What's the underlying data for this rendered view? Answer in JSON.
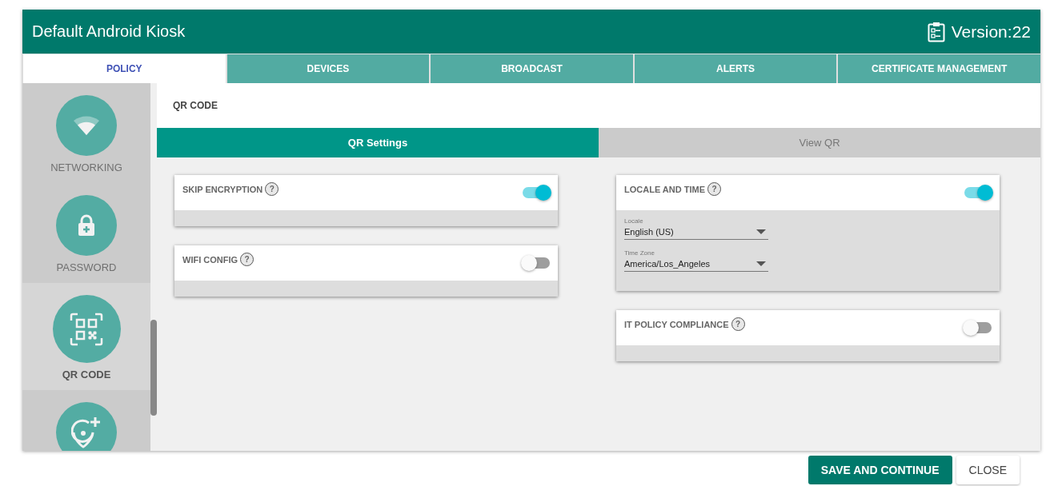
{
  "header": {
    "title": "Default Android Kiosk",
    "version": "Version:22"
  },
  "tabs": [
    {
      "label": "POLICY",
      "selected": true
    },
    {
      "label": "DEVICES",
      "selected": false
    },
    {
      "label": "BROADCAST",
      "selected": false
    },
    {
      "label": "ALERTS",
      "selected": false
    },
    {
      "label": "CERTIFICATE MANAGEMENT",
      "selected": false
    }
  ],
  "sidebar": {
    "items": [
      {
        "kind": "wifi",
        "label": "NETWORKING",
        "selected": false
      },
      {
        "kind": "lock",
        "label": "PASSWORD",
        "selected": false
      },
      {
        "kind": "qr",
        "label": "QR CODE",
        "selected": true
      },
      {
        "kind": "location",
        "selected": false
      }
    ]
  },
  "section_title": "QR CODE",
  "subtabs": [
    {
      "label": "QR Settings",
      "selected": true
    },
    {
      "label": "View QR",
      "selected": false
    }
  ],
  "columns": [
    [
      {
        "title": "SKIP ENCRYPTION",
        "help": "?",
        "on": true
      },
      {
        "title": "WIFI CONFIG",
        "help": "?",
        "on": false
      }
    ],
    [
      {
        "title": "LOCALE AND TIME",
        "help": "?",
        "on": true,
        "fields": [
          {
            "label": "Locale",
            "value": "English (US)"
          },
          {
            "label": "Time Zone",
            "value": "America/Los_Angeles"
          }
        ]
      },
      {
        "title": "IT POLICY COMPLIANCE",
        "help": "?",
        "on": false
      }
    ]
  ],
  "buttons": [
    {
      "label": "SAVE AND CONTINUE",
      "kind": "primary"
    },
    {
      "label": "CLOSE",
      "kind": "secondary"
    }
  ]
}
